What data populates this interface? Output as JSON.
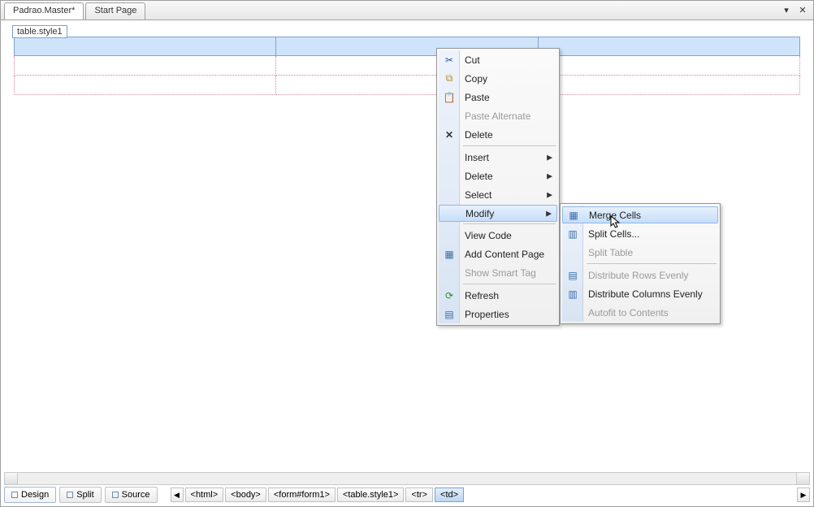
{
  "tabs": {
    "active": "Padrao.Master*",
    "other": "Start Page"
  },
  "tag_indicator": "table.style1",
  "context_menu": {
    "items": [
      {
        "label": "Cut",
        "icon": "cut"
      },
      {
        "label": "Copy",
        "icon": "copy"
      },
      {
        "label": "Paste",
        "icon": "paste"
      },
      {
        "label": "Paste Alternate",
        "disabled": true
      },
      {
        "label": "Delete",
        "icon": "delete"
      },
      {
        "sep": true
      },
      {
        "label": "Insert",
        "submenu": true
      },
      {
        "label": "Delete",
        "submenu": true
      },
      {
        "label": "Select",
        "submenu": true
      },
      {
        "label": "Modify",
        "submenu": true,
        "hover": true
      },
      {
        "sep": true
      },
      {
        "label": "View Code"
      },
      {
        "label": "Add Content Page",
        "icon": "grid"
      },
      {
        "label": "Show Smart Tag",
        "disabled": true
      },
      {
        "sep": true
      },
      {
        "label": "Refresh",
        "icon": "refresh"
      },
      {
        "label": "Properties",
        "icon": "grid"
      }
    ]
  },
  "submenu": {
    "items": [
      {
        "label": "Merge Cells",
        "icon": "grid",
        "hover": true
      },
      {
        "label": "Split Cells...",
        "icon": "grid"
      },
      {
        "label": "Split Table",
        "disabled": true
      },
      {
        "sep": true
      },
      {
        "label": "Distribute Rows Evenly",
        "icon": "grid",
        "disabled": true
      },
      {
        "label": "Distribute Columns Evenly",
        "icon": "grid"
      },
      {
        "label": "Autofit to Contents",
        "disabled": true
      }
    ]
  },
  "views": {
    "design": "Design",
    "split": "Split",
    "source": "Source"
  },
  "breadcrumbs": [
    "<html>",
    "<body>",
    "<form#form1>",
    "<table.style1>",
    "<tr>",
    "<td>"
  ]
}
